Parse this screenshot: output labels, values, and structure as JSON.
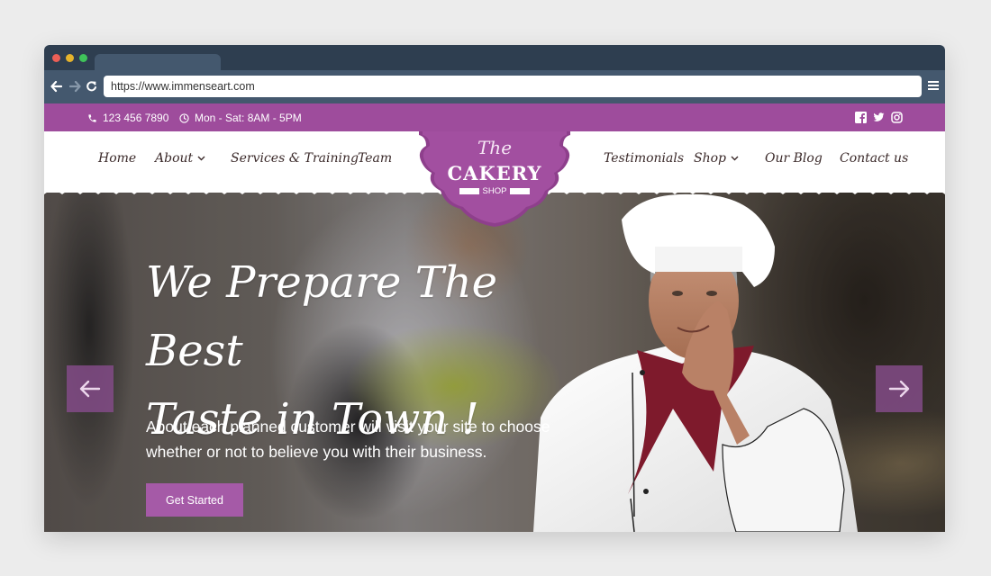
{
  "browser": {
    "url": "https://www.immenseart.com",
    "nav": {
      "back_icon": "arrow-left-icon",
      "forward_icon": "arrow-right-icon",
      "reload_icon": "reload-icon",
      "menu_icon": "hamburger-icon"
    }
  },
  "topbar": {
    "phone": "123 456 7890",
    "hours": "Mon - Sat: 8AM - 5PM",
    "social": [
      "facebook",
      "twitter",
      "instagram"
    ]
  },
  "nav": {
    "left": [
      {
        "label": "Home",
        "dropdown": false
      },
      {
        "label": "About",
        "dropdown": true
      },
      {
        "label": "Services & Training",
        "dropdown": false
      },
      {
        "label": "Team",
        "dropdown": false
      }
    ],
    "right": [
      {
        "label": "Testimonials",
        "dropdown": false
      },
      {
        "label": "Shop",
        "dropdown": true
      },
      {
        "label": "Our Blog",
        "dropdown": false
      },
      {
        "label": "Contact us",
        "dropdown": false
      }
    ]
  },
  "logo": {
    "the": "The",
    "name": "CAKERY",
    "tagline": "SHOP"
  },
  "hero": {
    "headline_line1": "We Prepare The Best",
    "headline_line2": "Taste in Town !",
    "subtext_line1": "About each planned customer will visit your site to choose",
    "subtext_line2": "whether or not to believe you with their business.",
    "cta_label": "Get Started"
  },
  "colors": {
    "brand": "#9e4c9c",
    "button": "#a55aa7",
    "browser_chrome": "#2e3e50",
    "toolbar": "#44586e"
  }
}
